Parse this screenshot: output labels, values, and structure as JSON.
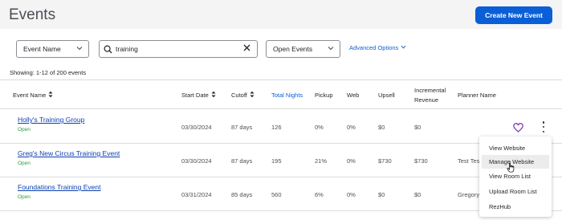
{
  "page": {
    "title": "Events",
    "create_button": "Create New Event"
  },
  "filters": {
    "field_select": "Event Name",
    "search_value": "training",
    "status_select": "Open Events",
    "advanced_options": "Advanced Options"
  },
  "showing": "Showing: 1-12 of 200 events",
  "table": {
    "headers": {
      "event_name": "Event Name",
      "start_date": "Start Date",
      "cutoff": "Cutoff",
      "total_nights": "Total Nights",
      "pickup": "Pickup",
      "web": "Web",
      "upsell": "Upsell",
      "incremental_revenue_1": "Incremental",
      "incremental_revenue_2": "Revenue",
      "planner_name": "Planner Name"
    },
    "rows": [
      {
        "name": "Holly's Training Group",
        "status": "Open",
        "start_date": "03/30/2024",
        "cutoff": "87 days",
        "total_nights": "126",
        "pickup": "0%",
        "web": "0%",
        "upsell": "$0",
        "incremental_revenue": "$0",
        "planner": ""
      },
      {
        "name": "Greg's New Circus Training Event",
        "status": "Open",
        "start_date": "03/30/2024",
        "cutoff": "87 days",
        "total_nights": "195",
        "pickup": "21%",
        "web": "0%",
        "upsell": "$730",
        "incremental_revenue": "$730",
        "planner": "Test Tes"
      },
      {
        "name": "Foundations Training Event",
        "status": "Open",
        "start_date": "03/31/2024",
        "cutoff": "85 days",
        "total_nights": "560",
        "pickup": "6%",
        "web": "0%",
        "upsell": "$0",
        "incremental_revenue": "$0",
        "planner": "Gregory"
      }
    ]
  },
  "row_menu": {
    "items": [
      "View Website",
      "Manage Website",
      "View Room List",
      "Upload Room List",
      "RezHub"
    ],
    "hovered": "Manage Website"
  },
  "icons": {
    "sort": "sort-icon",
    "search": "search-icon",
    "clear": "close-icon",
    "chevron": "chevron-down-icon",
    "favorite": "heart-icon",
    "more": "kebab-icon",
    "cursor": "hand-cursor-icon"
  },
  "colors": {
    "accent": "#0a5fd6",
    "link": "#0a3fb0",
    "open_status": "#2a9d3c",
    "favorite": "#7b3fb5"
  }
}
